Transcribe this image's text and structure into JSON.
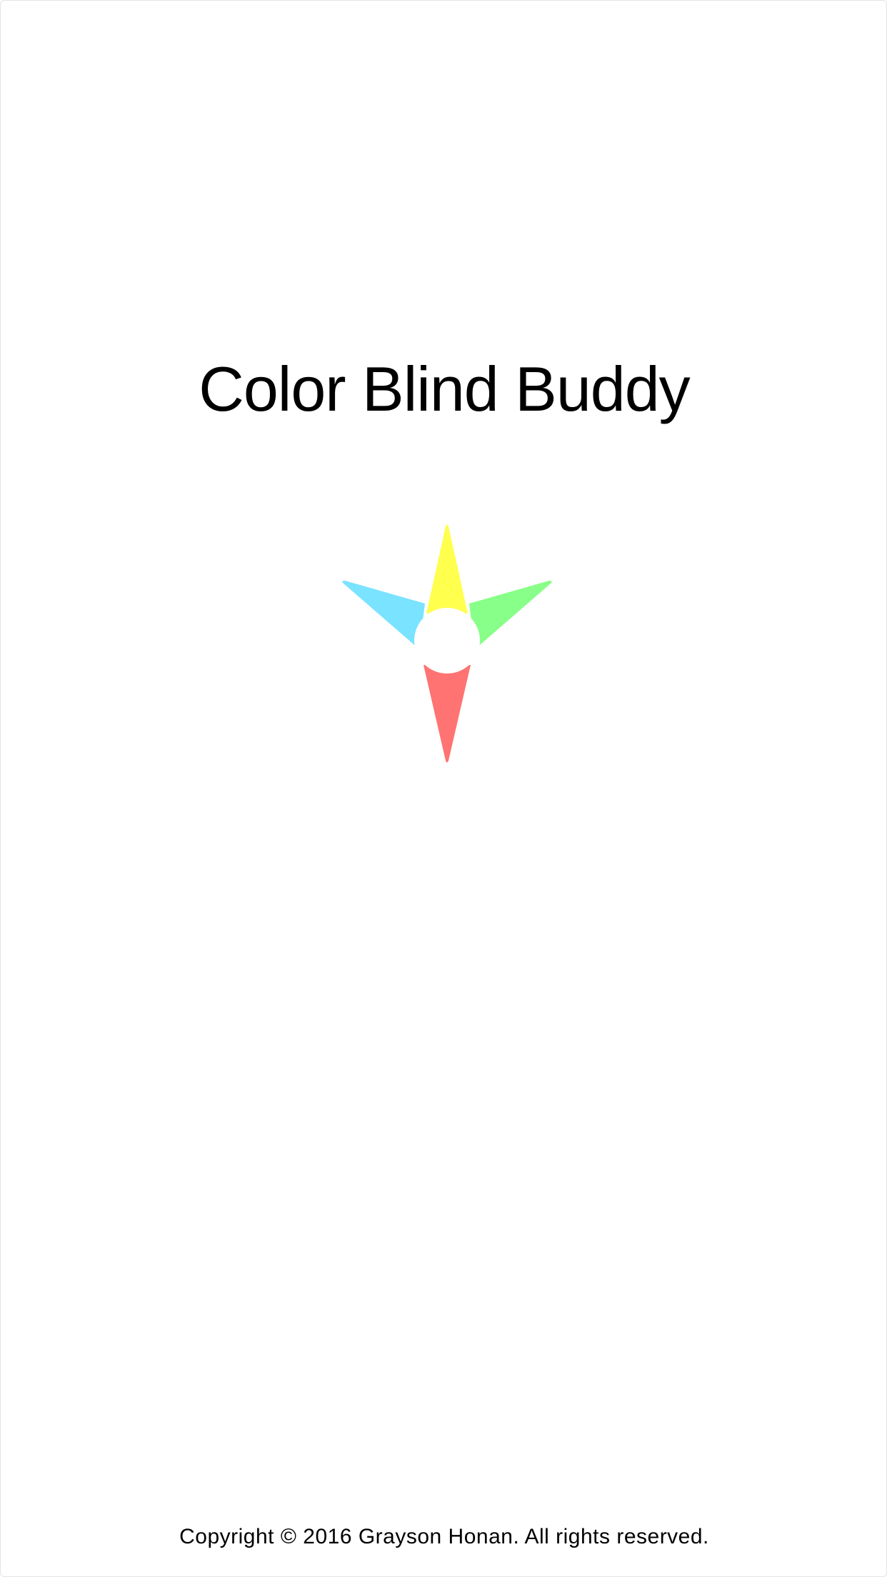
{
  "app": {
    "title": "Color Blind Buddy",
    "copyright": "Copyright © 2016 Grayson Honan. All rights reserved."
  },
  "logo": {
    "icon": "compass-star-icon",
    "colors": {
      "top": "#FFFF4D",
      "left": "#7AE3FF",
      "right": "#88FF88",
      "bottom": "#FF7373",
      "center": "#FFFFFF"
    }
  }
}
